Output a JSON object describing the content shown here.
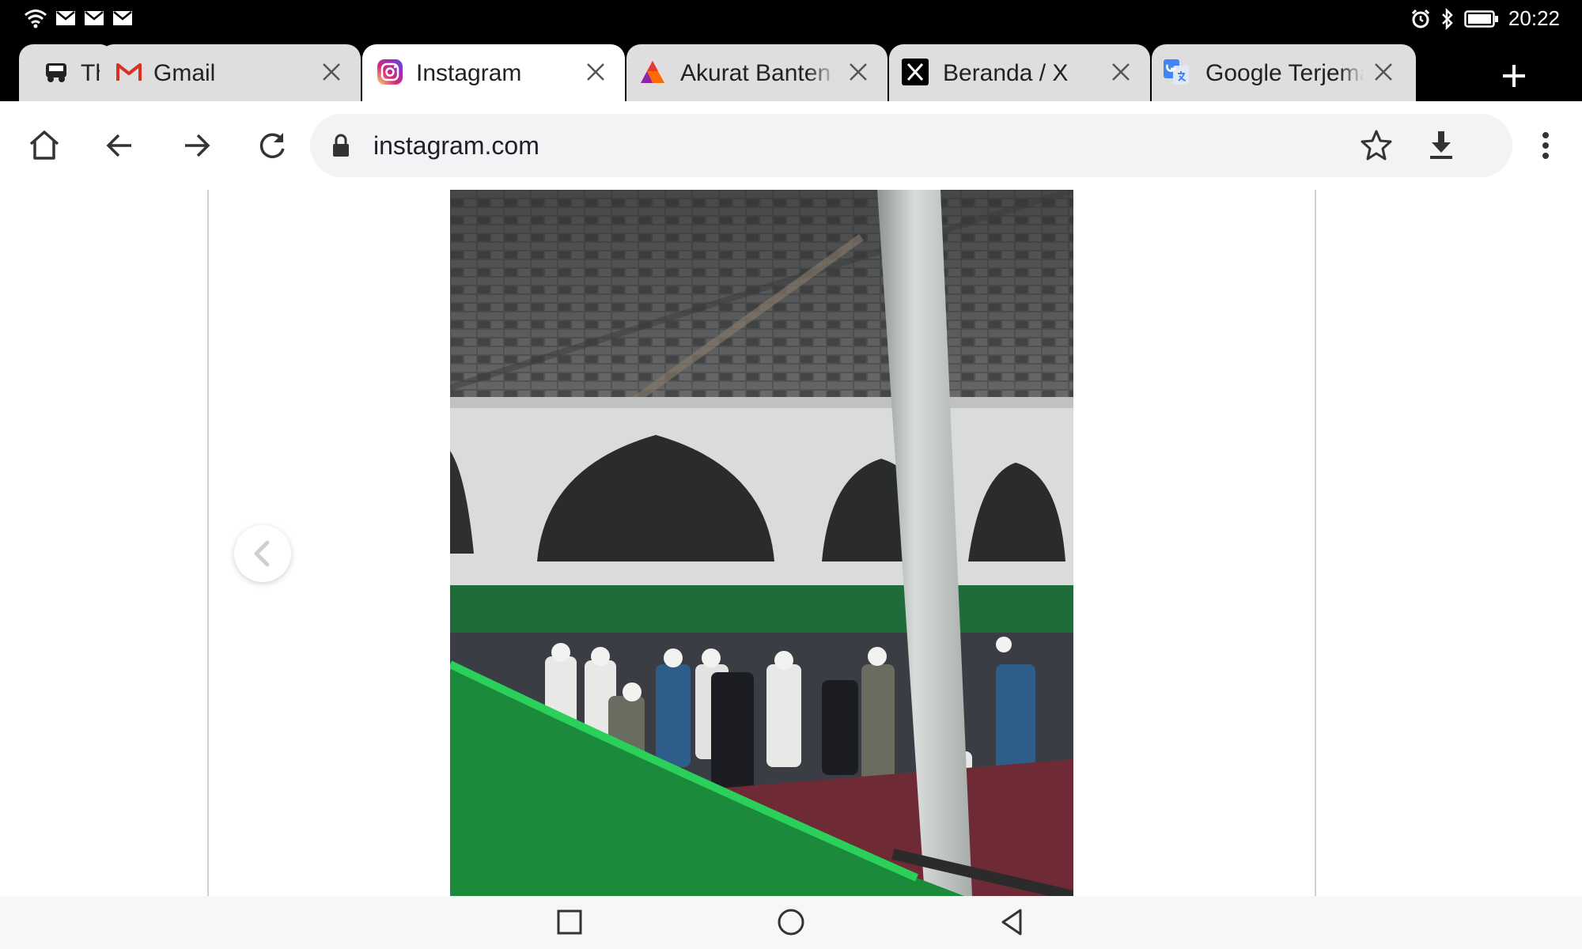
{
  "status_bar": {
    "time": "20:22",
    "left_icons": [
      "wifi-icon",
      "mail-icon",
      "mail-icon",
      "mail-icon"
    ],
    "right_icons": [
      "alarm-icon",
      "bluetooth-icon",
      "battery-icon"
    ]
  },
  "tabs": [
    {
      "title": "Th",
      "favicon": "car-icon",
      "active": false
    },
    {
      "title": "Gmail",
      "favicon": "gmail-icon",
      "active": false
    },
    {
      "title": "Instagram",
      "favicon": "instagram-icon",
      "active": true
    },
    {
      "title": "Akurat Banten -",
      "favicon": "akurat-icon",
      "active": false
    },
    {
      "title": "Beranda / X",
      "favicon": "x-icon",
      "active": false
    },
    {
      "title": "Google Terjemahan",
      "favicon": "google-translate-icon",
      "active": false
    }
  ],
  "toolbar": {
    "url": "instagram.com",
    "buttons": [
      "home-icon",
      "back-icon",
      "forward-icon",
      "reload-icon",
      "bookmark-star-icon",
      "download-icon",
      "more-icon"
    ]
  },
  "colors": {
    "tab_strip": "#000000",
    "inactive_tab": "#dedede",
    "omnibox": "#f1f3f4",
    "instagram_gradient": [
      "#feda75",
      "#d62976",
      "#962fbf",
      "#4f5bd5"
    ],
    "gmail_red": "#d93025",
    "akurat_orange": "#ff6a00",
    "google_blue": "#4285f4"
  },
  "page": {
    "image_subject": "photo-mosque-prayer",
    "prev_button": "chevron-left-icon"
  },
  "nav_bar": {
    "buttons": [
      "recent-apps-icon",
      "home-circle-icon",
      "back-triangle-icon"
    ]
  }
}
